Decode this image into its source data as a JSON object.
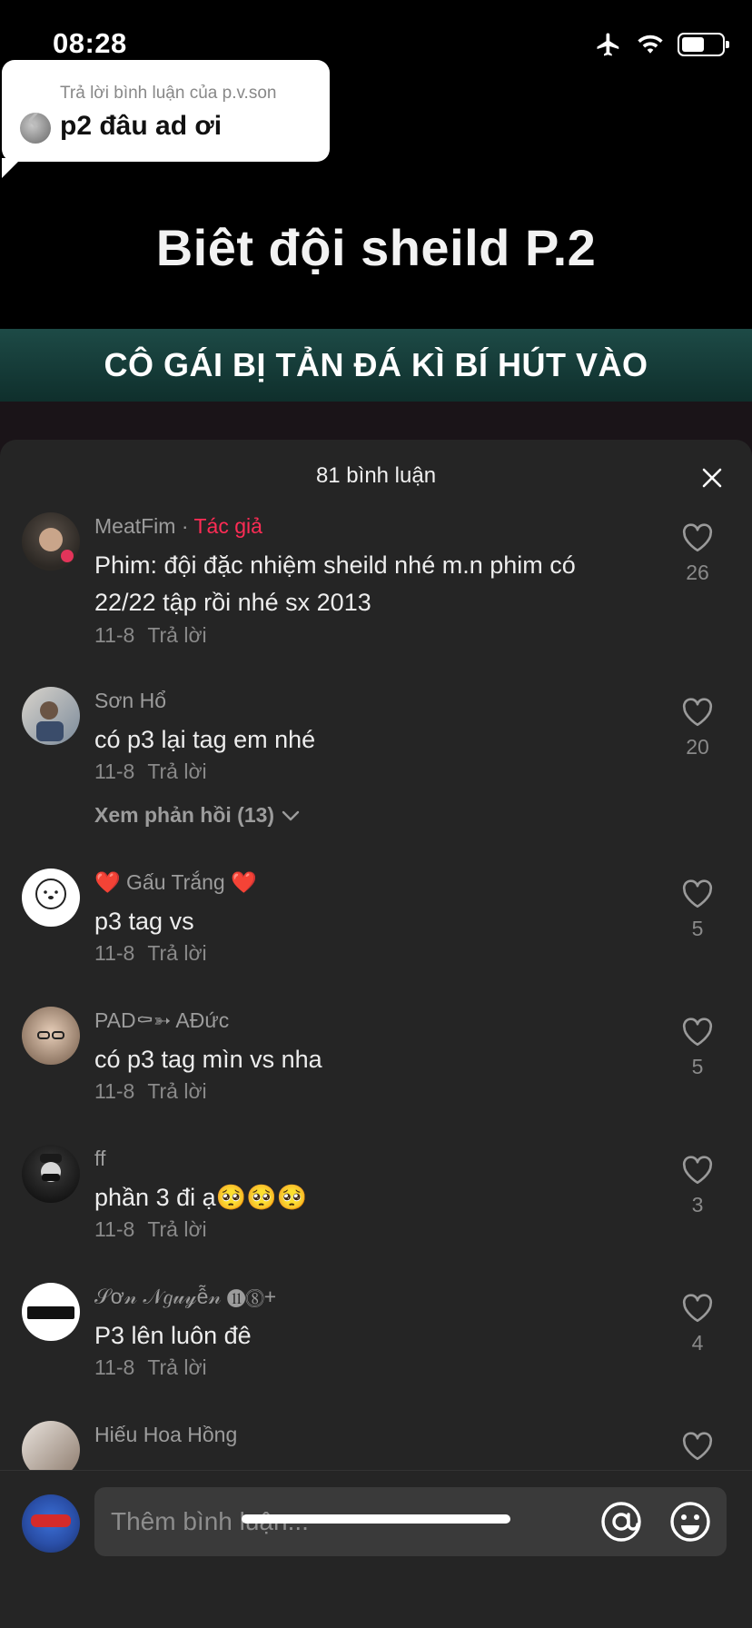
{
  "status_bar": {
    "time": "08:28",
    "battery_level": 0.58
  },
  "video": {
    "reply_label": "Trả lời bình luận của p.v.son",
    "reply_text": "p2 đâu ad ơi",
    "title": "Biêt đội sheild P.2",
    "banner": "CÔ GÁI BỊ TẢN ĐÁ KÌ BÍ  HÚT VÀO"
  },
  "comments_sheet": {
    "title": "81 bình luận",
    "comments": [
      {
        "user": "MeatFim",
        "badge_sep": " · ",
        "badge": "Tác giả",
        "text": "Phim: đội đặc nhiệm sheild nhé m.n phim có 22/22 tập rồi nhé sx 2013",
        "date": "11-8",
        "reply": "Trả lời",
        "likes": "26"
      },
      {
        "user": "Sơn Hổ",
        "text": "có p3 lại tag em nhé",
        "date": "11-8",
        "reply": "Trả lời",
        "likes": "20",
        "view_replies": "Xem phản hồi (13)"
      },
      {
        "user": "❤️ Gấu Trắng ❤️",
        "text": "p3 tag vs",
        "date": "11-8",
        "reply": "Trả lời",
        "likes": "5"
      },
      {
        "user": "PAD⚰➳ AĐức",
        "text": "có p3 tag mìn vs nha",
        "date": "11-8",
        "reply": "Trả lời",
        "likes": "5"
      },
      {
        "user": "ff",
        "text": "phần 3 đi ạ🥺🥺🥺",
        "date": "11-8",
        "reply": "Trả lời",
        "likes": "3"
      },
      {
        "user": "𝒮ơ𝓃 𝒩𝑔𝓊𝓎ễ𝓃 ⓫⓼+",
        "text": "P3 lên luôn đê",
        "date": "11-8",
        "reply": "Trả lời",
        "likes": "4"
      },
      {
        "user": "Hiếu Hoa Hồng"
      }
    ]
  },
  "input": {
    "placeholder": "Thêm bình luận..."
  },
  "colors": {
    "sheet_bg": "#252525",
    "author_badge": "#fe2c55",
    "banner": "#1d4a46"
  },
  "icons": [
    "airplane-icon",
    "wifi-icon",
    "battery-icon",
    "close-icon",
    "heart-icon",
    "chevron-down-icon",
    "at-icon",
    "emoji-icon"
  ]
}
